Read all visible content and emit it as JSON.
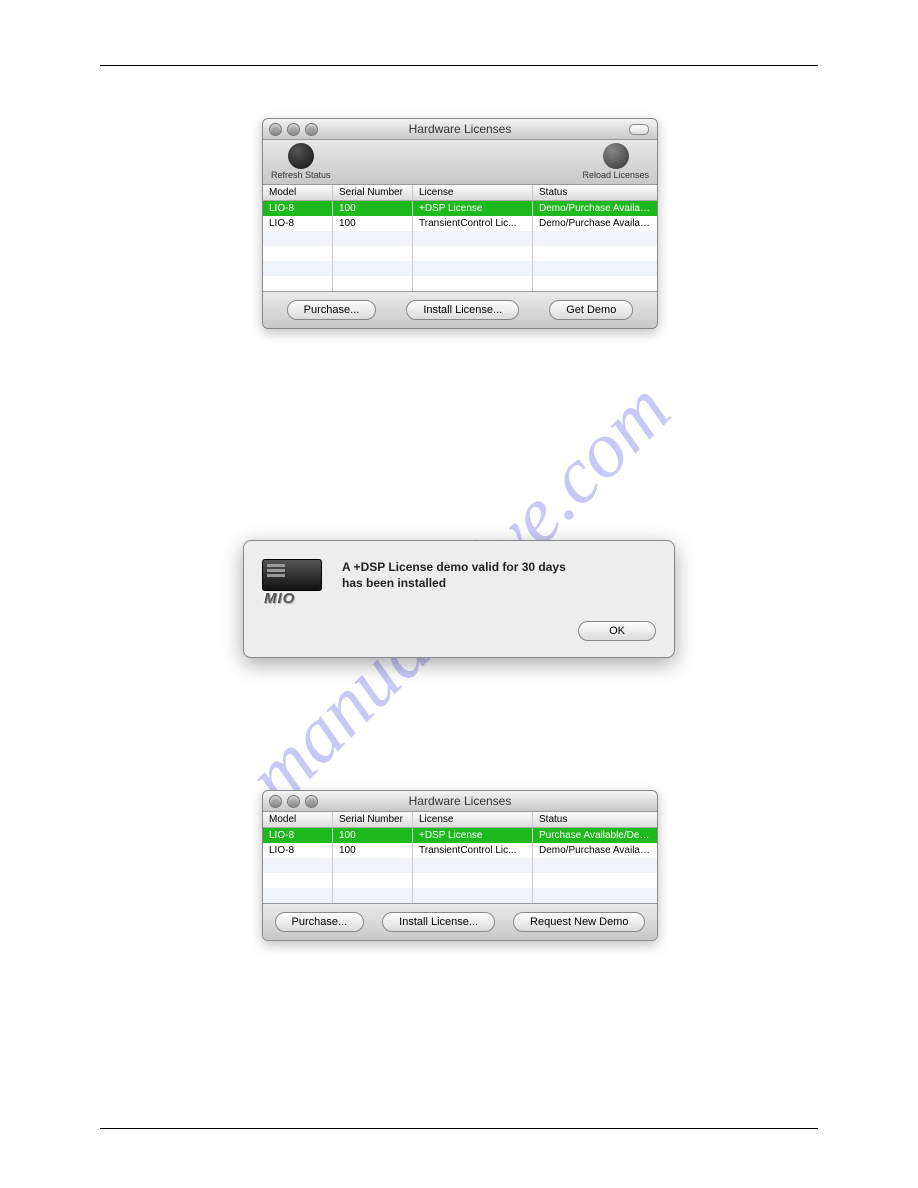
{
  "watermark": "manualshive.com",
  "win1": {
    "title": "Hardware Licenses",
    "refresh": "Refresh Status",
    "reload": "Reload Licenses",
    "headers": {
      "model": "Model",
      "serial": "Serial Number",
      "license": "License",
      "status": "Status"
    },
    "rows": [
      {
        "model": "LIO-8",
        "serial": "100",
        "license": "+DSP License",
        "status": "Demo/Purchase Available"
      },
      {
        "model": "LIO-8",
        "serial": "100",
        "license": "TransientControl Lic...",
        "status": "Demo/Purchase Available"
      }
    ],
    "buttons": {
      "purchase": "Purchase...",
      "install": "Install License...",
      "demo": "Get Demo"
    }
  },
  "dialog": {
    "message_l1": "A +DSP License demo valid for 30 days",
    "message_l2": "has been installed",
    "mio_label": "MIO",
    "ok": "OK"
  },
  "win2": {
    "title": "Hardware Licenses",
    "headers": {
      "model": "Model",
      "serial": "Serial Number",
      "license": "License",
      "status": "Status"
    },
    "rows": [
      {
        "model": "LIO-8",
        "serial": "100",
        "license": "+DSP License",
        "status": "Purchase Available/Dem..."
      },
      {
        "model": "LIO-8",
        "serial": "100",
        "license": "TransientControl Lic...",
        "status": "Demo/Purchase Available"
      }
    ],
    "buttons": {
      "purchase": "Purchase...",
      "install": "Install License...",
      "demo": "Request New Demo"
    }
  }
}
